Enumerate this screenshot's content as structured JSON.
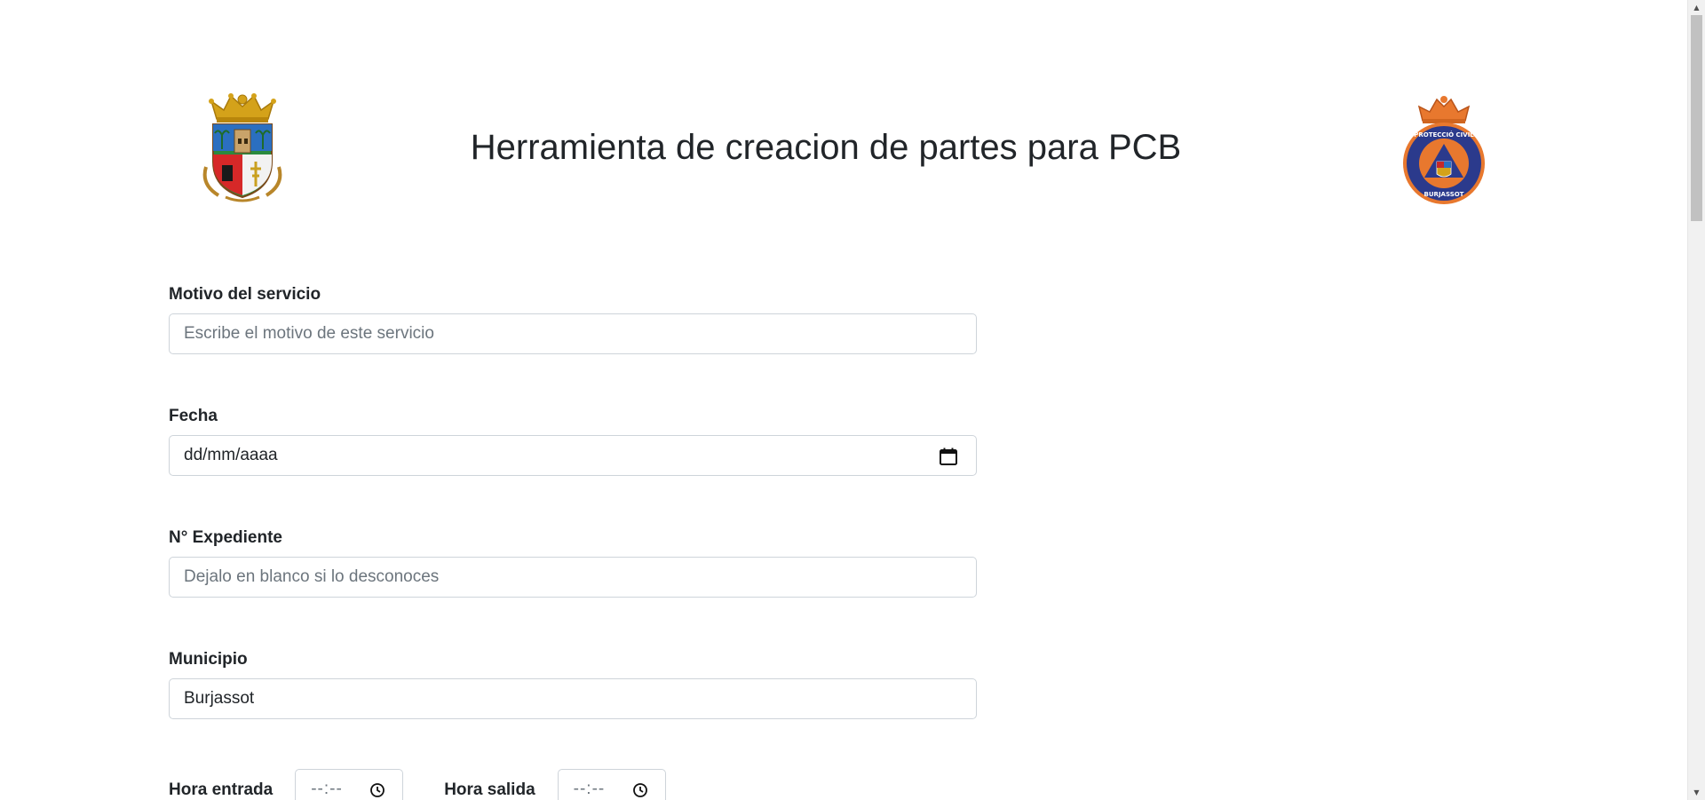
{
  "header": {
    "title": "Herramienta de creacion de partes para PCB",
    "logo_left_icon": "burjassot-coat-of-arms-icon",
    "logo_right_icon": "proteccio-civil-burjassot-emblem-icon",
    "logo_right_text_top": "PROTECCIÓ CIVIL",
    "logo_right_text_bottom": "BURJASSOT"
  },
  "form": {
    "motivo": {
      "label": "Motivo del servicio",
      "placeholder": "Escribe el motivo de este servicio",
      "value": ""
    },
    "fecha": {
      "label": "Fecha",
      "display": "dd/mm/aaaa",
      "icon": "calendar-icon"
    },
    "expediente": {
      "label": "N° Expediente",
      "placeholder": "Dejalo en blanco si lo desconoces",
      "value": ""
    },
    "municipio": {
      "label": "Municipio",
      "value": "Burjassot"
    },
    "hora_entrada": {
      "label": "Hora entrada",
      "display": "--:--",
      "icon": "clock-icon"
    },
    "hora_salida": {
      "label": "Hora salida",
      "display": "--:--",
      "icon": "clock-icon"
    }
  },
  "colors": {
    "text": "#212529",
    "placeholder": "#6c757d",
    "border": "#ced4da",
    "pc_orange": "#e8782e",
    "pc_blue": "#2b3a8c"
  }
}
